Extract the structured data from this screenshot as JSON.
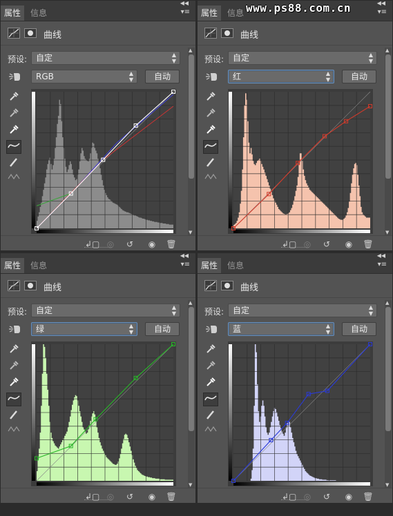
{
  "watermark": "www.ps88.com.cn",
  "panels": [
    {
      "tabs": [
        "属性",
        "信息"
      ],
      "title": "曲线",
      "preset_label": "预设:",
      "preset_value": "自定",
      "channel": "RGB",
      "auto_label": "自动",
      "channel_color": "#ffffff",
      "hist_fill": "#8c8c8c",
      "curve_points": [
        [
          0,
          0
        ],
        [
          64,
          65
        ],
        [
          124,
          128
        ],
        [
          185,
          192
        ],
        [
          255,
          255
        ]
      ],
      "extra_lines": [
        {
          "color": "#3aa63a",
          "points": [
            [
              0,
              42
            ],
            [
              64,
              65
            ]
          ]
        },
        {
          "color": "#4040d8",
          "points": [
            [
              0,
              0
            ],
            [
              64,
              65
            ],
            [
              150,
              160
            ],
            [
              255,
              250
            ]
          ]
        },
        {
          "color": "#cc3333",
          "points": [
            [
              0,
              0
            ],
            [
              124,
              128
            ],
            [
              255,
              228
            ]
          ]
        }
      ],
      "histogram": [
        14,
        22,
        30,
        40,
        48,
        60,
        72,
        84,
        95,
        110,
        120,
        128,
        132,
        120,
        110,
        118,
        130,
        150,
        170,
        195,
        210,
        240,
        232,
        200,
        170,
        150,
        130,
        115,
        105,
        110,
        118,
        125,
        120,
        110,
        100,
        95,
        90,
        92,
        100,
        110,
        125,
        140,
        150,
        145,
        135,
        130,
        128,
        126,
        125,
        130,
        140,
        150,
        160,
        158,
        150,
        145,
        140,
        130,
        120,
        112,
        100,
        90,
        80,
        72,
        66,
        62,
        58,
        55,
        54,
        52,
        50,
        48,
        47,
        46,
        45,
        44,
        42,
        40,
        38,
        36,
        34,
        33,
        32,
        31,
        30,
        30,
        29,
        28,
        27,
        26,
        25,
        24,
        24,
        23,
        22,
        21,
        20,
        20,
        19,
        18,
        18,
        17,
        16,
        16,
        15,
        15,
        14,
        14,
        13,
        13,
        12,
        12,
        12,
        11,
        11,
        10,
        10,
        10,
        9,
        9,
        9,
        8,
        8,
        8,
        7,
        7,
        7,
        7
      ]
    },
    {
      "tabs": [
        "属性",
        "信息"
      ],
      "title": "曲线",
      "preset_label": "预设:",
      "preset_value": "自定",
      "channel": "红",
      "auto_label": "自动",
      "channel_color": "#d43a2a",
      "hist_fill": "#f5c3ad",
      "curve_points": [
        [
          0,
          0
        ],
        [
          66,
          64
        ],
        [
          120,
          122
        ],
        [
          170,
          172
        ],
        [
          210,
          200
        ],
        [
          255,
          228
        ]
      ],
      "extra_lines": [],
      "histogram": [
        6,
        8,
        10,
        14,
        20,
        30,
        46,
        70,
        110,
        170,
        230,
        252,
        240,
        200,
        160,
        140,
        150,
        138,
        126,
        120,
        118,
        122,
        126,
        128,
        130,
        126,
        120,
        115,
        110,
        104,
        98,
        92,
        86,
        80,
        74,
        68,
        62,
        56,
        52,
        48,
        44,
        40,
        36,
        34,
        32,
        30,
        28,
        27,
        26,
        26,
        27,
        28,
        30,
        34,
        38,
        44,
        52,
        60,
        70,
        80,
        96,
        120,
        140,
        140,
        126,
        110,
        98,
        90,
        84,
        80,
        76,
        72,
        70,
        68,
        66,
        64,
        62,
        60,
        58,
        56,
        54,
        52,
        50,
        48,
        46,
        44,
        42,
        40,
        38,
        36,
        34,
        32,
        30,
        28,
        26,
        24,
        22,
        20,
        18,
        17,
        16,
        16,
        16,
        18,
        20,
        24,
        30,
        38,
        50,
        66,
        84,
        100,
        112,
        120,
        122,
        118,
        100,
        80,
        60,
        40,
        30,
        26,
        24,
        22,
        20,
        20,
        20,
        20
      ]
    },
    {
      "tabs": [
        "属性",
        "信息"
      ],
      "title": "曲线",
      "preset_label": "预设:",
      "preset_value": "自定",
      "channel": "绿",
      "auto_label": "自动",
      "channel_color": "#28b828",
      "hist_fill": "#c8f7b0",
      "curve_points": [
        [
          0,
          42
        ],
        [
          64,
          65
        ],
        [
          110,
          115
        ],
        [
          185,
          192
        ],
        [
          255,
          255
        ]
      ],
      "extra_lines": [],
      "histogram": [
        18,
        40,
        60,
        90,
        140,
        200,
        255,
        250,
        230,
        200,
        170,
        140,
        110,
        90,
        80,
        74,
        70,
        66,
        64,
        62,
        60,
        64,
        68,
        72,
        76,
        80,
        84,
        88,
        92,
        100,
        110,
        120,
        132,
        142,
        150,
        156,
        160,
        158,
        150,
        140,
        130,
        120,
        110,
        100,
        96,
        92,
        88,
        90,
        96,
        104,
        112,
        120,
        126,
        130,
        124,
        112,
        100,
        90,
        80,
        72,
        66,
        60,
        56,
        52,
        48,
        44,
        42,
        40,
        38,
        36,
        34,
        32,
        31,
        30,
        30,
        32,
        36,
        42,
        50,
        60,
        70,
        78,
        86,
        88,
        86,
        80,
        72,
        64,
        56,
        48,
        40,
        34,
        28,
        24,
        20,
        18,
        16,
        14,
        12,
        11,
        10,
        9,
        8,
        8,
        7,
        7,
        6,
        6,
        5,
        5,
        5,
        4,
        4,
        4,
        4,
        3,
        3,
        3,
        3,
        3,
        2,
        2,
        2,
        2,
        2,
        2,
        2,
        2
      ]
    },
    {
      "tabs": [
        "属性",
        "信息"
      ],
      "title": "曲线",
      "preset_label": "预设:",
      "preset_value": "自定",
      "channel": "蓝",
      "auto_label": "自动",
      "channel_color": "#2a3ad8",
      "hist_fill": "#d2d4f8",
      "curve_points": [
        [
          0,
          0
        ],
        [
          70,
          76
        ],
        [
          100,
          108
        ],
        [
          140,
          162
        ],
        [
          175,
          168
        ],
        [
          255,
          255
        ]
      ],
      "extra_lines": [],
      "histogram": [
        0,
        0,
        0,
        0,
        0,
        0,
        0,
        0,
        0,
        0,
        0,
        0,
        0,
        0,
        0,
        0,
        4,
        20,
        60,
        140,
        255,
        240,
        180,
        130,
        110,
        120,
        140,
        150,
        140,
        120,
        100,
        90,
        86,
        90,
        100,
        110,
        120,
        130,
        136,
        134,
        128,
        120,
        112,
        104,
        98,
        92,
        88,
        84,
        90,
        100,
        108,
        112,
        110,
        100,
        90,
        80,
        72,
        64,
        56,
        50,
        46,
        42,
        38,
        34,
        30,
        26,
        22,
        18,
        16,
        14,
        12,
        10,
        9,
        8,
        7,
        6,
        5,
        5,
        4,
        4,
        3,
        3,
        3,
        2,
        2,
        2,
        2,
        1,
        1,
        1,
        1,
        1,
        1,
        1,
        1,
        1,
        0,
        0,
        0,
        0,
        0,
        0,
        0,
        0,
        0,
        0,
        0,
        0,
        0,
        0,
        0,
        0,
        0,
        0,
        0,
        0,
        0,
        0,
        0,
        0,
        0,
        0,
        0,
        0,
        0,
        0,
        0,
        0
      ]
    }
  ]
}
